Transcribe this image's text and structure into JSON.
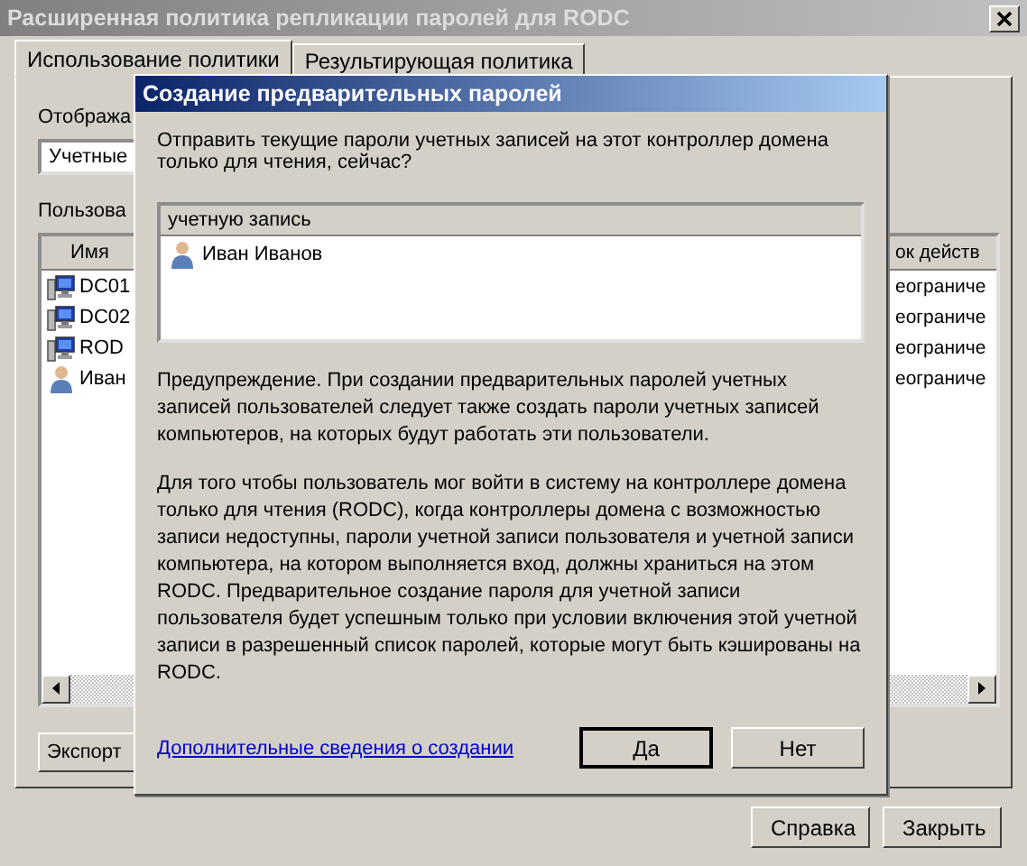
{
  "window": {
    "title": "Расширенная политика репликации паролей для RODC"
  },
  "tabs": [
    {
      "label": "Использование политики",
      "selected": true
    },
    {
      "label": "Результирующая политика",
      "selected": false
    }
  ],
  "display_label": "Отобража",
  "display_combo": {
    "value": "Учетные"
  },
  "users_label": "Пользова",
  "users_list": {
    "columns": [
      "Имя",
      "ок действ"
    ],
    "rows": [
      {
        "kind": "computer",
        "name": "DC01",
        "column_2": "еограниче"
      },
      {
        "kind": "computer",
        "name": "DC02",
        "column_2": "еограниче"
      },
      {
        "kind": "computer",
        "name": "ROD",
        "column_2": "еограниче"
      },
      {
        "kind": "user",
        "name": "Иван",
        "column_2": "еограниче"
      }
    ]
  },
  "export_button": "Экспорт",
  "buttons": [
    "Справка",
    "Закрыть"
  ],
  "dialog": {
    "title": "Создание предварительных паролей",
    "question": "Отправить текущие пароли учетных записей на этот контроллер домена только для чтения, сейчас?",
    "list": {
      "column": "учетную запись",
      "rows": [
        {
          "kind": "user",
          "name": "Иван Иванов"
        }
      ]
    },
    "warning": "Предупреждение. При создании предварительных паролей учетных записей пользователей следует также создать пароли учетных записей компьютеров, на которых будут работать эти пользователи.",
    "info": "Для того чтобы пользователь мог войти в систему на контроллере домена только для чтения (RODC), когда контроллеры домена с возможностью записи недоступны, пароли учетной записи пользователя и учетной записи компьютера, на котором выполняется вход, должны храниться на этом RODC. Предварительное создание пароля для учетной записи пользователя будет успешным только при условии включения этой учетной записи в разрешенный список паролей, которые могут быть кэшированы на RODC.",
    "link": "Дополнительные сведения о создании",
    "buttons": [
      {
        "label": "Да",
        "default": true
      },
      {
        "label": "Нет",
        "default": false
      }
    ]
  }
}
